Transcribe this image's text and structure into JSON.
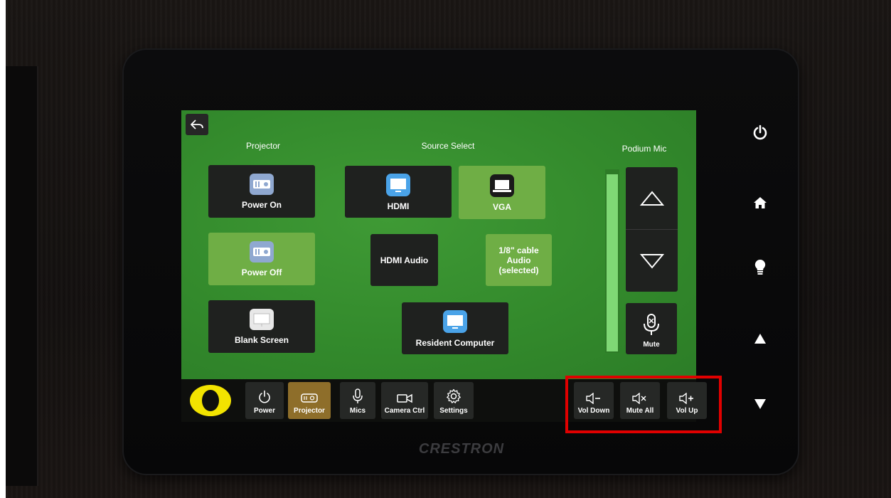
{
  "device": {
    "brand": "CRESTRON"
  },
  "screen": {
    "sections": {
      "projector": "Projector",
      "source_select": "Source Select",
      "podium_mic": "Podium Mic"
    },
    "projector_buttons": [
      {
        "label": "Power On",
        "icon": "projector-icon",
        "state": "dark"
      },
      {
        "label": "Power Off",
        "icon": "projector-icon",
        "state": "selected"
      },
      {
        "label": "Blank Screen",
        "icon": "screen-icon",
        "state": "dark"
      }
    ],
    "source_buttons": {
      "hdmi": "HDMI",
      "vga": "VGA",
      "hdmi_audio": "HDMI Audio",
      "cable_audio": "1/8\" cable Audio (selected)",
      "resident_computer": "Resident Computer"
    },
    "mic": {
      "mute_label": "Mute",
      "level": 0.98
    }
  },
  "bottom_nav": {
    "power": "Power",
    "projector": "Projector",
    "mics": "Mics",
    "camera": "Camera Ctrl",
    "settings": "Settings",
    "vol_down": "Vol Down",
    "mute_all": "Mute All",
    "vol_up": "Vol Up",
    "active": "Projector"
  },
  "colors": {
    "screen_green": "#338a2c",
    "selected_green": "#6fae45",
    "active_tab": "#8e6e2a",
    "highlight": "#e00000"
  },
  "hardware_buttons": [
    "power-icon",
    "home-icon",
    "lightbulb-icon",
    "up-arrow-icon",
    "down-arrow-icon"
  ]
}
